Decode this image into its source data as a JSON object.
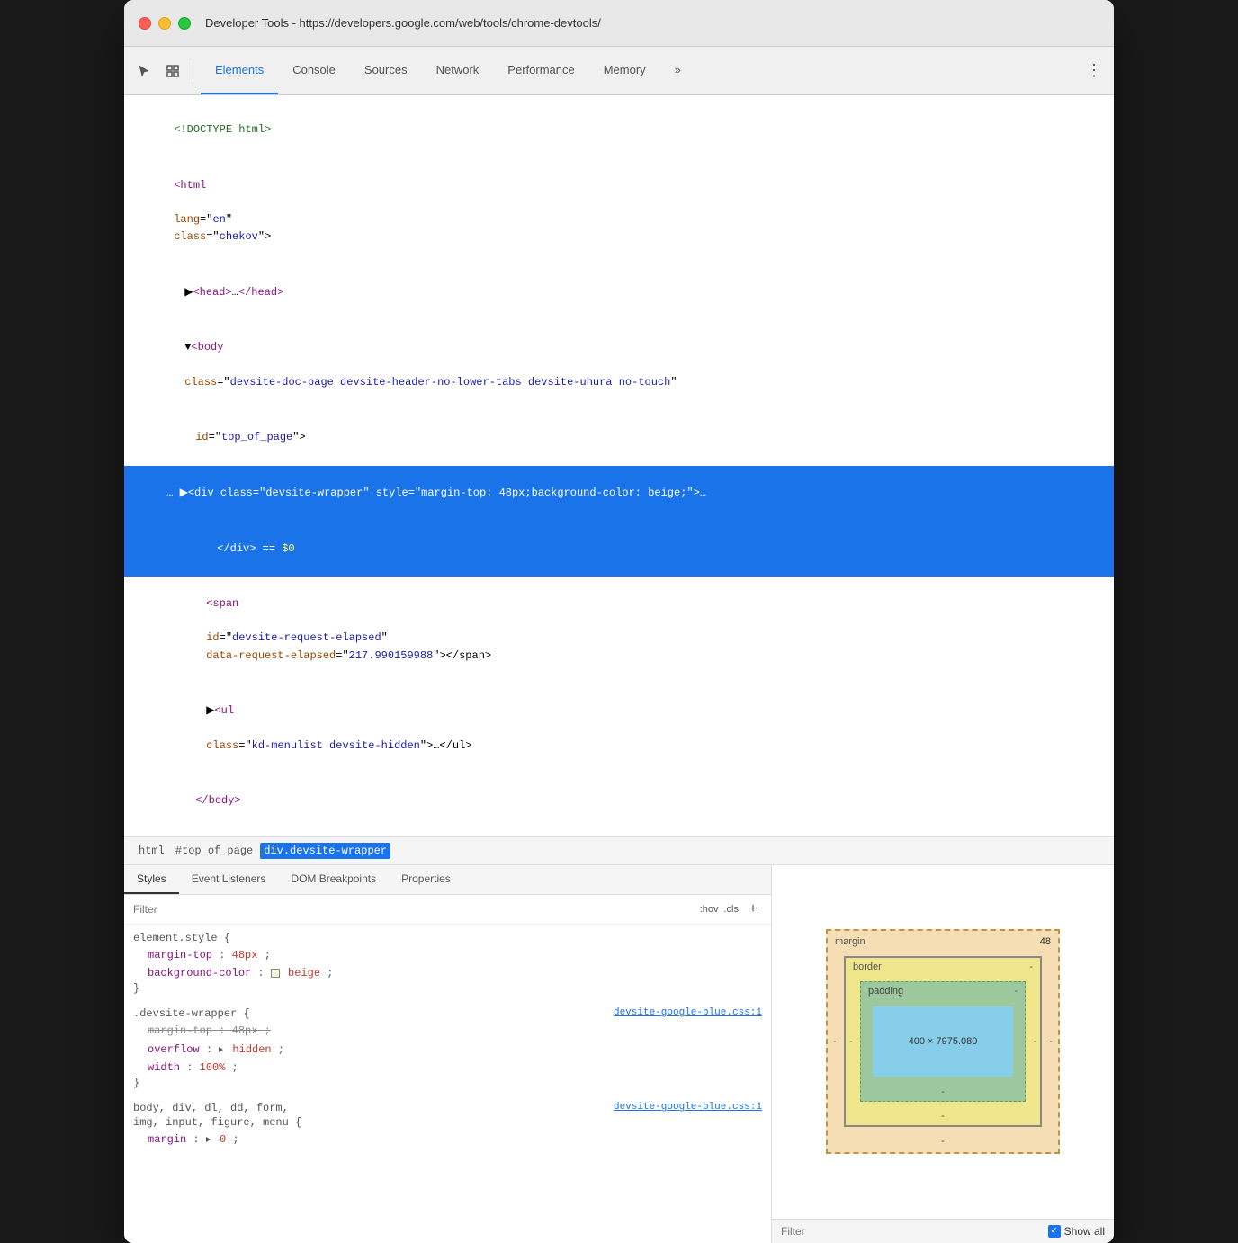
{
  "window": {
    "title": "Developer Tools - https://developers.google.com/web/tools/chrome-devtools/"
  },
  "toolbar": {
    "tabs": [
      {
        "label": "Elements",
        "active": true
      },
      {
        "label": "Console",
        "active": false
      },
      {
        "label": "Sources",
        "active": false
      },
      {
        "label": "Network",
        "active": false
      },
      {
        "label": "Performance",
        "active": false
      },
      {
        "label": "Memory",
        "active": false
      }
    ],
    "more_label": "»",
    "menu_label": "⋮"
  },
  "dom": {
    "lines": [
      {
        "text": "<!DOCTYPE html>",
        "indent": 0,
        "type": "comment"
      },
      {
        "text": "<html lang=\"en\" class=\"chekov\">",
        "indent": 0,
        "type": "tag"
      },
      {
        "text": "▶<head>…</head>",
        "indent": 1,
        "type": "tag"
      },
      {
        "text": "▼<body class=\"devsite-doc-page devsite-header-no-lower-tabs devsite-uhura no-touch\"",
        "indent": 1,
        "type": "tag"
      },
      {
        "text": "id=\"top_of_page\">",
        "indent": 2,
        "type": "attr"
      },
      {
        "text": "… ▶<div class=\"devsite-wrapper\" style=\"margin-top: 48px;background-color: beige;\">…",
        "indent": 0,
        "type": "selected"
      },
      {
        "text": "</div> == $0",
        "indent": 3,
        "type": "selected2"
      },
      {
        "text": "<span id=\"devsite-request-elapsed\" data-request-elapsed=\"217.990159988\"></span>",
        "indent": 3,
        "type": "tag"
      },
      {
        "text": "▶<ul class=\"kd-menulist devsite-hidden\">…</ul>",
        "indent": 3,
        "type": "tag"
      },
      {
        "text": "</body>",
        "indent": 2,
        "type": "tag"
      }
    ]
  },
  "breadcrumb": {
    "items": [
      {
        "label": "html",
        "active": false
      },
      {
        "label": "#top_of_page",
        "active": false
      },
      {
        "label": "div.devsite-wrapper",
        "active": true
      }
    ]
  },
  "bottom_panel": {
    "tabs": [
      "Styles",
      "Event Listeners",
      "DOM Breakpoints",
      "Properties"
    ],
    "active_tab": "Styles",
    "filter_placeholder": "Filter",
    "filter_hints": [
      ":hov",
      ".cls",
      "+"
    ],
    "css_rules": [
      {
        "selector": "element.style {",
        "link": "",
        "props": [
          {
            "name": "margin-top",
            "value": "48px",
            "color": null,
            "strikethrough": false
          },
          {
            "name": "background-color",
            "value": "beige",
            "color": "beige",
            "strikethrough": false
          }
        ]
      },
      {
        "selector": ".devsite-wrapper {",
        "link": "devsite-google-blue.css:1",
        "props": [
          {
            "name": "margin-top",
            "value": "48px",
            "color": null,
            "strikethrough": true
          },
          {
            "name": "overflow",
            "value": "hidden",
            "color": null,
            "strikethrough": false,
            "has_triangle": true
          },
          {
            "name": "width",
            "value": "100%",
            "color": null,
            "strikethrough": false
          }
        ]
      },
      {
        "selector": "body, div, dl, dd, form,",
        "link": "devsite-google-blue.css:1",
        "selector2": "img, input, figure, menu {",
        "props": [
          {
            "name": "margin",
            "value": "▶ 0",
            "color": null,
            "strikethrough": false,
            "has_triangle": true
          }
        ]
      }
    ]
  },
  "box_model": {
    "margin_label": "margin",
    "margin_top": "48",
    "margin_other": "-",
    "border_label": "border",
    "border_value": "-",
    "padding_label": "padding",
    "padding_value": "-",
    "content_size": "400 × 7975.080",
    "filter_placeholder": "Filter",
    "show_all_label": "Show all"
  }
}
